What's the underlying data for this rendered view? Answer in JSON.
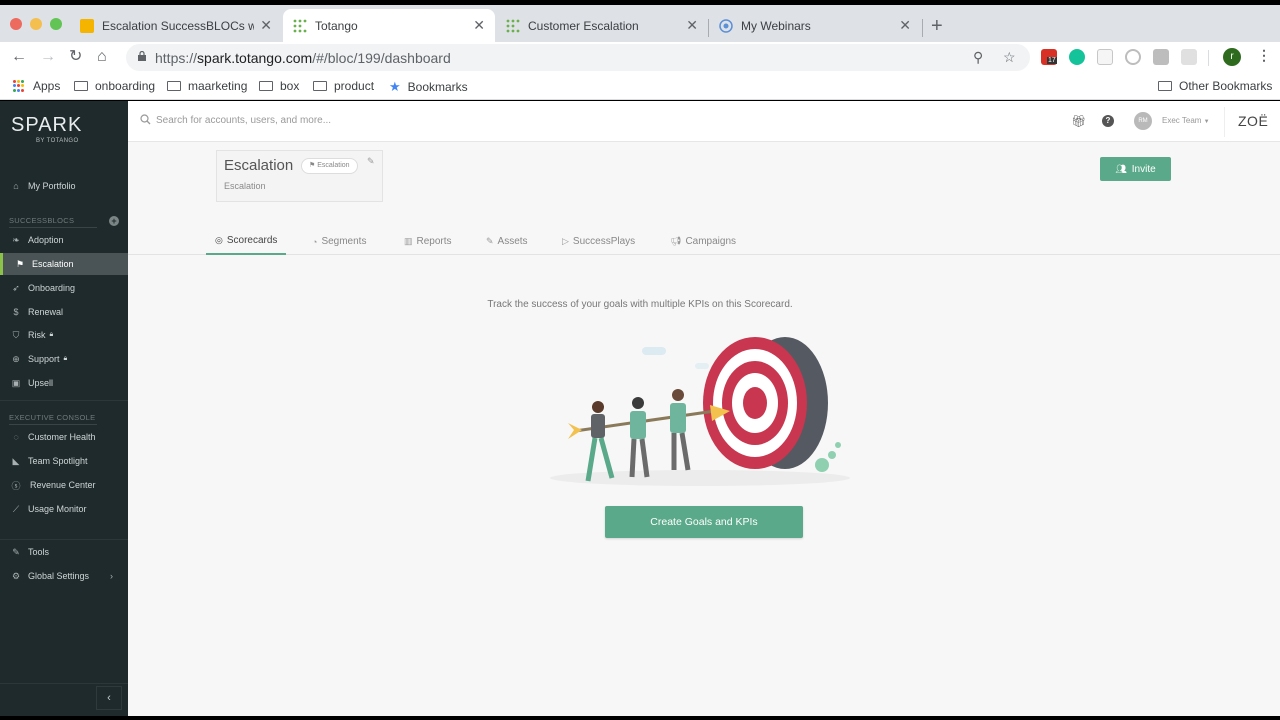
{
  "browser": {
    "tabs": [
      {
        "title": "Escalation SuccessBLOCs web",
        "active": false,
        "favicon": "slides-icon"
      },
      {
        "title": "Totango",
        "active": true,
        "favicon": "totango-icon"
      },
      {
        "title": "Customer Escalation",
        "active": false,
        "favicon": "totango-icon"
      },
      {
        "title": "My Webinars",
        "active": false,
        "favicon": "webinar-icon"
      }
    ],
    "url_prefix": "https://",
    "url_domain": "spark.totango.com",
    "url_path": "/#/bloc/199/dashboard",
    "extensions": [
      {
        "name": "calendar-extension",
        "badge": "17",
        "color": "#d93025"
      },
      {
        "name": "grammarly-extension",
        "color": "#15c39a"
      },
      {
        "name": "b-extension",
        "color": "#c7c7c7"
      },
      {
        "name": "circle-extension",
        "color": "#bdbdbd"
      },
      {
        "name": "g-extension",
        "color": "#bdbdbd"
      },
      {
        "name": "camera-extension",
        "color": "#d0d0d0"
      }
    ],
    "profile_initial": "r",
    "bookmarks": [
      "Apps",
      "onboarding",
      "maarketing",
      "box",
      "product",
      "Bookmarks"
    ],
    "other_bookmarks": "Other Bookmarks"
  },
  "sidebar": {
    "logo": "SPARK",
    "logo_sub": "BY TOTANGO",
    "portfolio": "My Portfolio",
    "successblocs_header": "SUCCESSBLOCS",
    "blocs": [
      {
        "label": "Adoption",
        "icon": "leaf-icon",
        "locked": false,
        "active": false
      },
      {
        "label": "Escalation",
        "icon": "flag-icon",
        "locked": false,
        "active": true
      },
      {
        "label": "Onboarding",
        "icon": "rocket-icon",
        "locked": false,
        "active": false
      },
      {
        "label": "Renewal",
        "icon": "dollar-icon",
        "locked": false,
        "active": false
      },
      {
        "label": "Risk",
        "icon": "shield-icon",
        "locked": true,
        "active": false
      },
      {
        "label": "Support",
        "icon": "lifebuoy-icon",
        "locked": true,
        "active": false
      },
      {
        "label": "Upsell",
        "icon": "upsell-icon",
        "locked": false,
        "active": false
      }
    ],
    "exec_header": "EXECUTIVE CONSOLE",
    "exec_items": [
      {
        "label": "Customer Health",
        "icon": "health-icon"
      },
      {
        "label": "Team Spotlight",
        "icon": "spotlight-icon"
      },
      {
        "label": "Revenue Center",
        "icon": "revenue-icon"
      },
      {
        "label": "Usage Monitor",
        "icon": "chart-icon"
      }
    ],
    "tools": "Tools",
    "global_settings": "Global Settings"
  },
  "header": {
    "search_placeholder": "Search for accounts, users, and more...",
    "avatar_initials": "RM",
    "team": "Exec Team",
    "brand": "ZOË"
  },
  "bloc": {
    "title": "Escalation",
    "badge": "Escalation",
    "subtitle": "Escalation",
    "invite_label": "Invite"
  },
  "tabs": [
    {
      "label": "Scorecards",
      "icon": "target-icon",
      "active": true
    },
    {
      "label": "Segments",
      "icon": "pie-icon",
      "active": false
    },
    {
      "label": "Reports",
      "icon": "bar-chart-icon",
      "active": false
    },
    {
      "label": "Assets",
      "icon": "paperclip-icon",
      "active": false
    },
    {
      "label": "SuccessPlays",
      "icon": "play-icon",
      "active": false
    },
    {
      "label": "Campaigns",
      "icon": "megaphone-icon",
      "active": false
    }
  ],
  "content": {
    "message": "Track the success of your goals with multiple KPIs on this Scorecard.",
    "cta_label": "Create Goals and KPIs"
  },
  "colors": {
    "accent": "#5aa98a",
    "sidebar_bg": "#1f2a2c",
    "active_marker": "#8bc34a",
    "target_red": "#c8364f"
  }
}
